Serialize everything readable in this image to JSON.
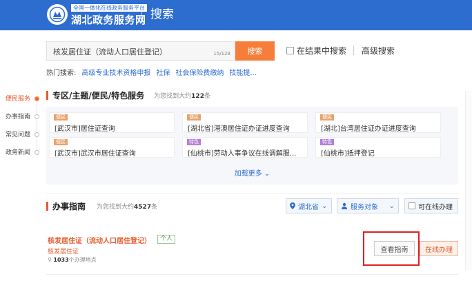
{
  "header": {
    "brand_sub": "全国一体化在线政务服务平台",
    "brand_main": "湖北政务服务网",
    "title": "搜索"
  },
  "search": {
    "query": "核发居住证（流动人口居住登记）",
    "count": "15/128",
    "button": "搜索",
    "in_results": "在结果中搜索",
    "advanced": "高级搜索"
  },
  "hot": {
    "label": "热门搜索:",
    "items": [
      "高级专业技术资格申报",
      "社保",
      "社会保险费缴纳",
      "技能提..."
    ]
  },
  "nav": {
    "items": [
      "便民服务",
      "办事指南",
      "常见问题",
      "政务新闻"
    ]
  },
  "special": {
    "title": "专区/主题/便民/特色服务",
    "count_prefix": "为您找到大约",
    "count": "122",
    "count_suffix": "条",
    "cards": [
      {
        "tag": "便民",
        "title": "[武汉市]居住证查询"
      },
      {
        "tag": "便民",
        "title": "[湖北省]港澳居住证办证进度查询"
      },
      {
        "tag": "便民",
        "title": "[湖北]台湾居住证办证进度查询"
      },
      {
        "tag": "便民",
        "title": "[武汉市]武汉市居住证查询"
      },
      {
        "tag": "特色",
        "title": "[仙桃市]劳动人事争议在线调解服..."
      },
      {
        "tag": "特色",
        "title": "[仙桃市]抵押登记"
      }
    ],
    "load_more": "加载更多 ⌄"
  },
  "guide": {
    "title": "办事指南",
    "count_prefix": "为您找到大约",
    "count": "4527",
    "count_suffix": "条",
    "filter_region": "湖北省",
    "filter_target": "服务对象",
    "filter_online": "可在线办理"
  },
  "result": {
    "title": "核发居住证（流动人口居住登记）",
    "tag": "个人",
    "subtitle": "核发居住证",
    "loc_count": "1033",
    "loc_suffix": "个办理地点",
    "view_guide": "查看指南",
    "online": "在线办理"
  },
  "colors": {
    "header_blue": "#2d6dd0",
    "accent_orange": "#f57f3a",
    "highlight_red": "#e02020"
  }
}
